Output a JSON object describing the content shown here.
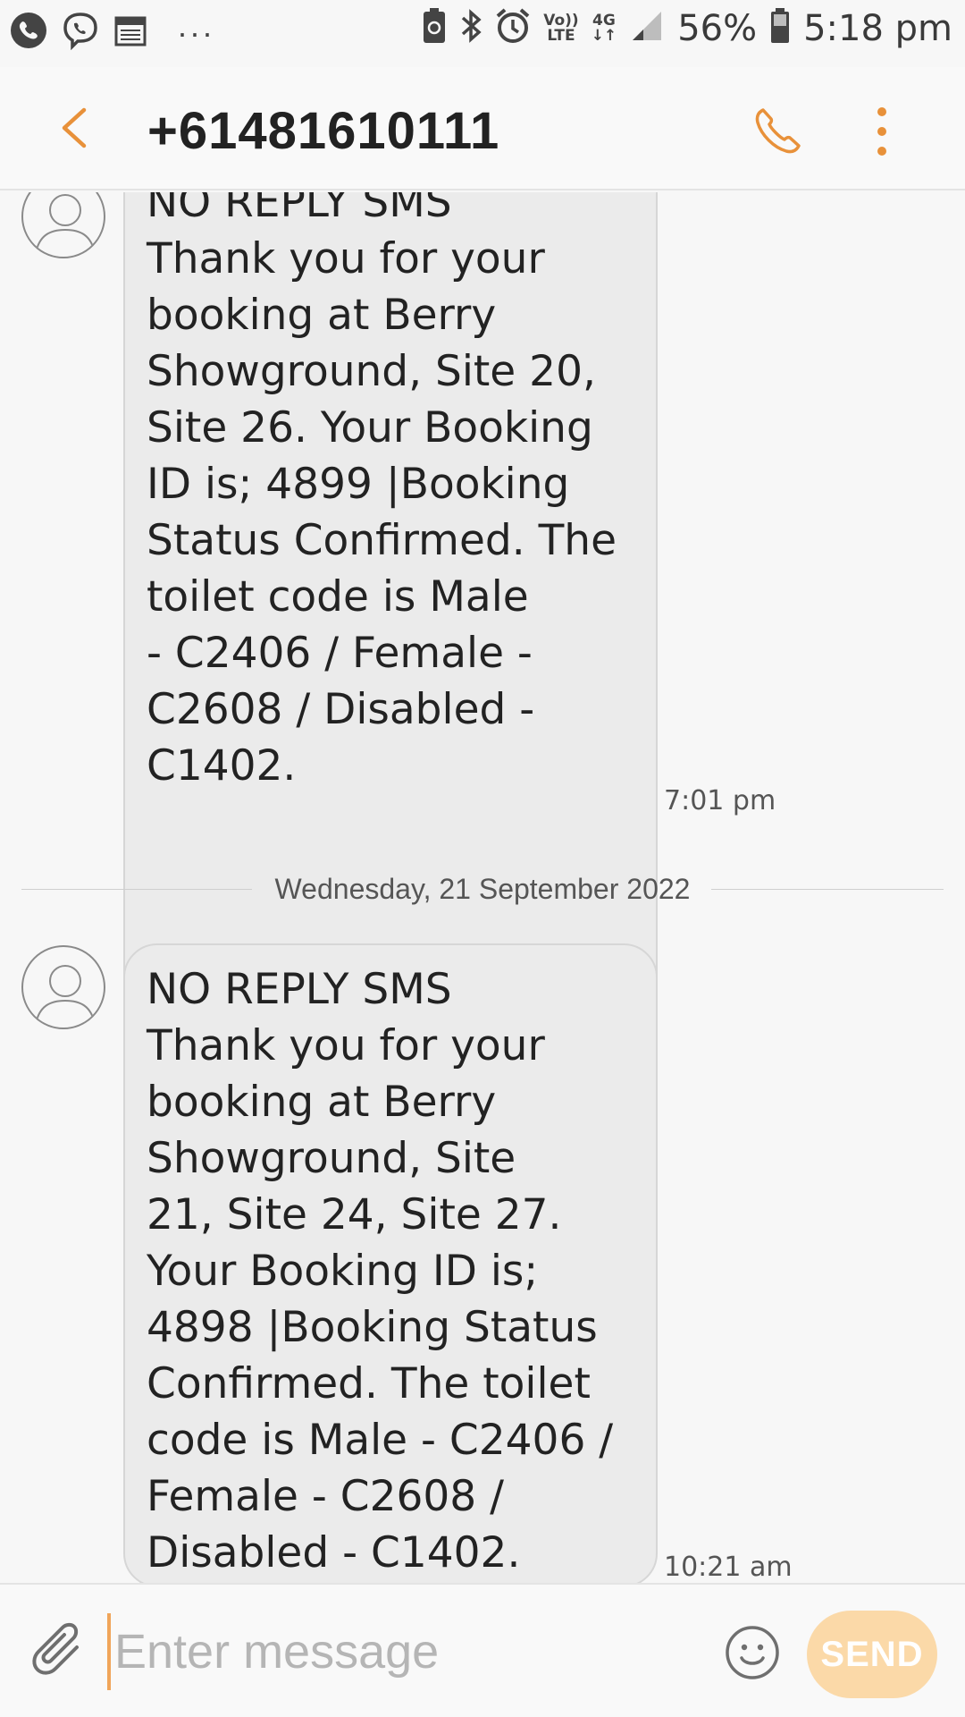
{
  "status_bar": {
    "battery_percent": "56%",
    "time": "5:18 pm",
    "volte_top": "Vo))",
    "volte_bottom": "LTE",
    "network_top": "4G",
    "network_bottom": "↓↑",
    "overflow": "···",
    "icons": [
      "phone-call-icon",
      "viber-icon",
      "calendar-icon",
      "battery-saver-icon",
      "bluetooth-icon",
      "alarm-icon",
      "volte-icon",
      "4g-icon",
      "signal-icon",
      "battery-icon"
    ]
  },
  "header": {
    "title": "+61481610111",
    "accent_color": "#e8913a"
  },
  "messages": [
    {
      "text": "NO REPLY SMS\nThank you for your\nbooking at Berry\nShowground, Site 20,\nSite 26. Your Booking\nID is; 4899 |Booking\nStatus Confirmed. The\ntoilet code is Male\n- C2406 / Female -\nC2608 / Disabled -\nC1402.",
      "time": "7:01 pm"
    },
    {
      "text": "NO REPLY SMS\nThank you for your\nbooking at Berry\nShowground, Site\n21, Site 24, Site 27.\nYour Booking ID is;\n4898 |Booking Status\nConfirmed. The toilet\ncode is Male - C2406 /\nFemale - C2608 /\nDisabled - C1402.",
      "time": "10:21 am"
    }
  ],
  "date_divider": "Wednesday, 21 September 2022",
  "composer": {
    "placeholder": "Enter message",
    "send_label": "SEND"
  }
}
